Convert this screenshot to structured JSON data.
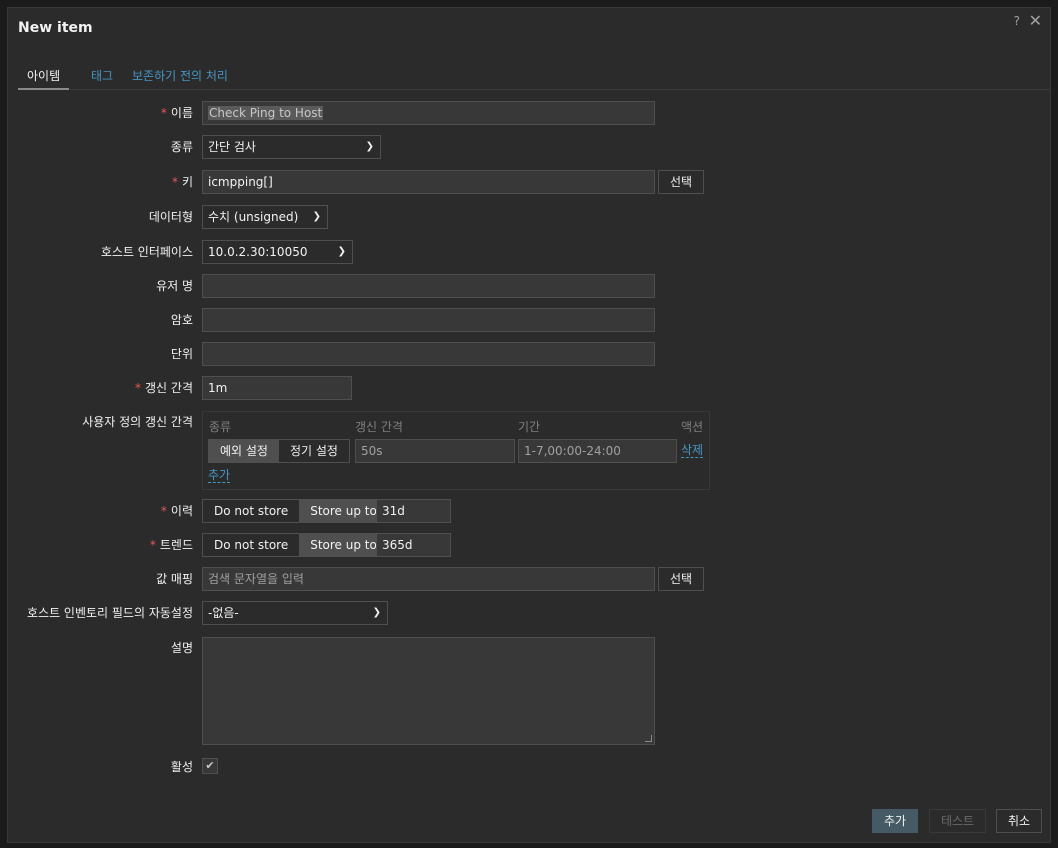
{
  "dialog": {
    "title": "New item",
    "help": "?",
    "close": "✕"
  },
  "tabs": [
    {
      "label": "아이템"
    },
    {
      "label": "태그"
    },
    {
      "label": "보존하기 전의 처리"
    }
  ],
  "form": {
    "name": {
      "label": "이름",
      "value": "Check Ping to Host"
    },
    "type": {
      "label": "종류",
      "value": "간단 검사"
    },
    "key": {
      "label": "키",
      "value": "icmpping[]",
      "button": "선택"
    },
    "datatype": {
      "label": "데이터형",
      "value": "수치 (unsigned)"
    },
    "interface": {
      "label": "호스트 인터페이스",
      "value": "10.0.2.30:10050"
    },
    "username": {
      "label": "유저 명",
      "value": ""
    },
    "password": {
      "label": "암호",
      "value": ""
    },
    "units": {
      "label": "단위",
      "value": ""
    },
    "interval": {
      "label": "갱신 간격",
      "value": "1m"
    },
    "custom_intervals": {
      "label": "사용자 정의 갱신 간격",
      "headers": {
        "type": "종류",
        "interval": "갱신 간격",
        "period": "기간",
        "action": "액션"
      },
      "type_flexible": "예외 설정",
      "type_scheduling": "정기 설정",
      "interval_placeholder": "50s",
      "period_placeholder": "1-7,00:00-24:00",
      "remove": "삭제",
      "add": "추가"
    },
    "history": {
      "label": "이력",
      "opt_no": "Do not store",
      "opt_yes": "Store up to",
      "value": "31d"
    },
    "trends": {
      "label": "트렌드",
      "opt_no": "Do not store",
      "opt_yes": "Store up to",
      "value": "365d"
    },
    "valuemap": {
      "label": "값 매핑",
      "placeholder": "검색 문자열을 입력",
      "button": "선택"
    },
    "inventory": {
      "label": "호스트 인벤토리 필드의 자동설정",
      "value": "-없음-"
    },
    "description": {
      "label": "설명",
      "value": ""
    },
    "enabled": {
      "label": "활성"
    }
  },
  "footer": {
    "add": "추가",
    "test": "테스트",
    "cancel": "취소"
  }
}
